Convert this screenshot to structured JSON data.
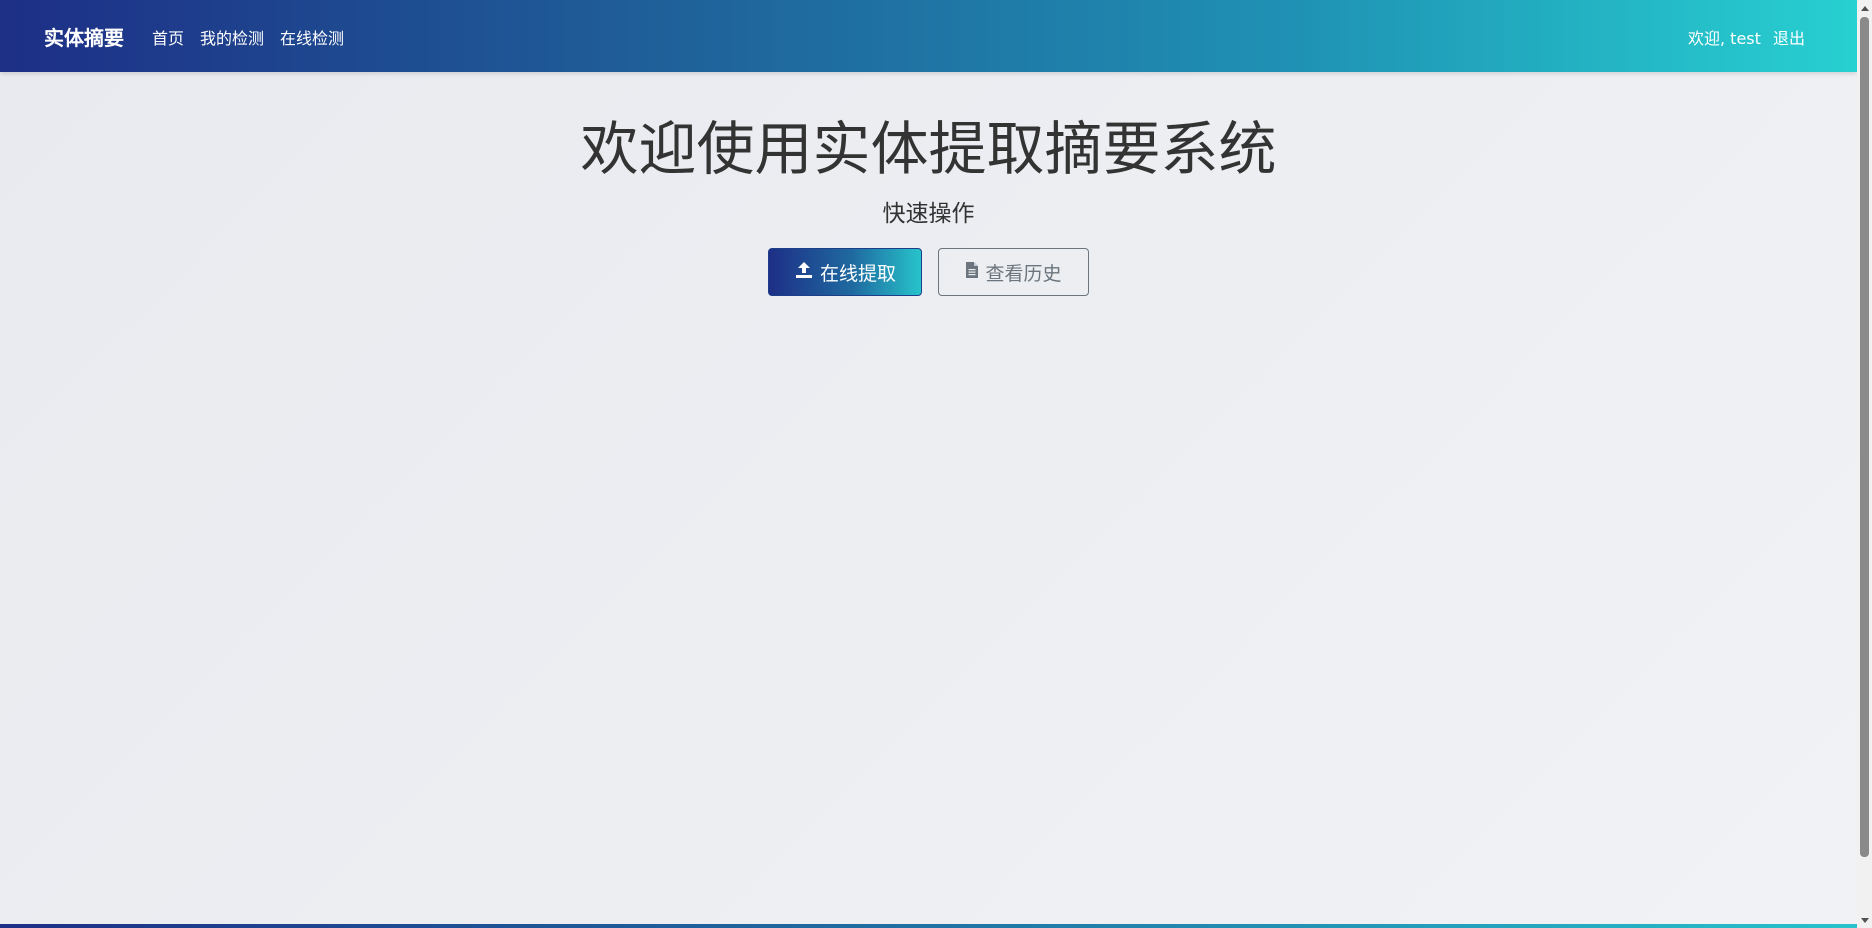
{
  "navbar": {
    "brand": "实体摘要",
    "links": [
      "首页",
      "我的检测",
      "在线检测"
    ],
    "welcome": "欢迎, test",
    "logout": "退出"
  },
  "main": {
    "title": "欢迎使用实体提取摘要系统",
    "subtitle": "快速操作",
    "primary_button": {
      "label": "在线提取",
      "icon": "upload-icon"
    },
    "secondary_button": {
      "label": "查看历史",
      "icon": "document-icon"
    }
  },
  "colors": {
    "navbar_start": "#1d2f86",
    "navbar_end": "#27d0d1",
    "secondary": "#6c757d"
  }
}
